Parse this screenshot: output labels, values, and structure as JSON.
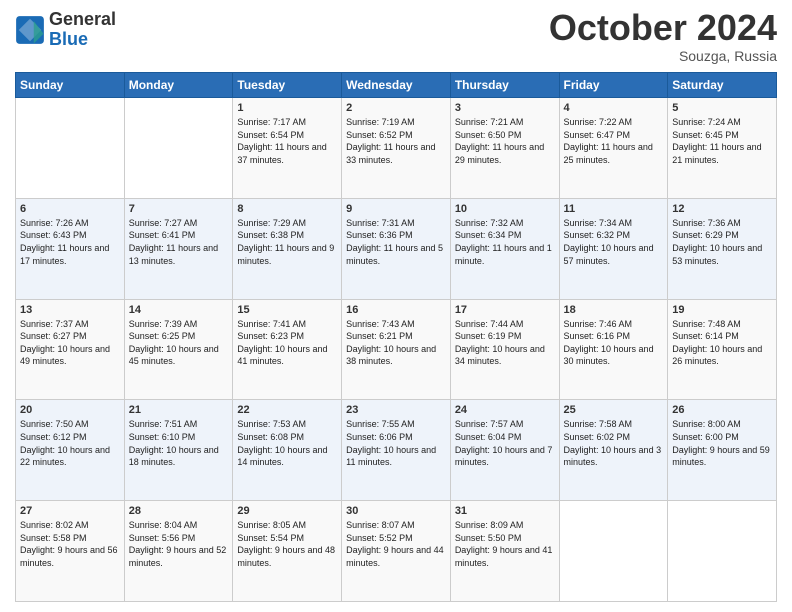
{
  "header": {
    "logo_text_general": "General",
    "logo_text_blue": "Blue",
    "month": "October 2024",
    "location": "Souzga, Russia"
  },
  "weekdays": [
    "Sunday",
    "Monday",
    "Tuesday",
    "Wednesday",
    "Thursday",
    "Friday",
    "Saturday"
  ],
  "weeks": [
    [
      {
        "day": "",
        "content": ""
      },
      {
        "day": "",
        "content": ""
      },
      {
        "day": "1",
        "content": "Sunrise: 7:17 AM\nSunset: 6:54 PM\nDaylight: 11 hours and 37 minutes."
      },
      {
        "day": "2",
        "content": "Sunrise: 7:19 AM\nSunset: 6:52 PM\nDaylight: 11 hours and 33 minutes."
      },
      {
        "day": "3",
        "content": "Sunrise: 7:21 AM\nSunset: 6:50 PM\nDaylight: 11 hours and 29 minutes."
      },
      {
        "day": "4",
        "content": "Sunrise: 7:22 AM\nSunset: 6:47 PM\nDaylight: 11 hours and 25 minutes."
      },
      {
        "day": "5",
        "content": "Sunrise: 7:24 AM\nSunset: 6:45 PM\nDaylight: 11 hours and 21 minutes."
      }
    ],
    [
      {
        "day": "6",
        "content": "Sunrise: 7:26 AM\nSunset: 6:43 PM\nDaylight: 11 hours and 17 minutes."
      },
      {
        "day": "7",
        "content": "Sunrise: 7:27 AM\nSunset: 6:41 PM\nDaylight: 11 hours and 13 minutes."
      },
      {
        "day": "8",
        "content": "Sunrise: 7:29 AM\nSunset: 6:38 PM\nDaylight: 11 hours and 9 minutes."
      },
      {
        "day": "9",
        "content": "Sunrise: 7:31 AM\nSunset: 6:36 PM\nDaylight: 11 hours and 5 minutes."
      },
      {
        "day": "10",
        "content": "Sunrise: 7:32 AM\nSunset: 6:34 PM\nDaylight: 11 hours and 1 minute."
      },
      {
        "day": "11",
        "content": "Sunrise: 7:34 AM\nSunset: 6:32 PM\nDaylight: 10 hours and 57 minutes."
      },
      {
        "day": "12",
        "content": "Sunrise: 7:36 AM\nSunset: 6:29 PM\nDaylight: 10 hours and 53 minutes."
      }
    ],
    [
      {
        "day": "13",
        "content": "Sunrise: 7:37 AM\nSunset: 6:27 PM\nDaylight: 10 hours and 49 minutes."
      },
      {
        "day": "14",
        "content": "Sunrise: 7:39 AM\nSunset: 6:25 PM\nDaylight: 10 hours and 45 minutes."
      },
      {
        "day": "15",
        "content": "Sunrise: 7:41 AM\nSunset: 6:23 PM\nDaylight: 10 hours and 41 minutes."
      },
      {
        "day": "16",
        "content": "Sunrise: 7:43 AM\nSunset: 6:21 PM\nDaylight: 10 hours and 38 minutes."
      },
      {
        "day": "17",
        "content": "Sunrise: 7:44 AM\nSunset: 6:19 PM\nDaylight: 10 hours and 34 minutes."
      },
      {
        "day": "18",
        "content": "Sunrise: 7:46 AM\nSunset: 6:16 PM\nDaylight: 10 hours and 30 minutes."
      },
      {
        "day": "19",
        "content": "Sunrise: 7:48 AM\nSunset: 6:14 PM\nDaylight: 10 hours and 26 minutes."
      }
    ],
    [
      {
        "day": "20",
        "content": "Sunrise: 7:50 AM\nSunset: 6:12 PM\nDaylight: 10 hours and 22 minutes."
      },
      {
        "day": "21",
        "content": "Sunrise: 7:51 AM\nSunset: 6:10 PM\nDaylight: 10 hours and 18 minutes."
      },
      {
        "day": "22",
        "content": "Sunrise: 7:53 AM\nSunset: 6:08 PM\nDaylight: 10 hours and 14 minutes."
      },
      {
        "day": "23",
        "content": "Sunrise: 7:55 AM\nSunset: 6:06 PM\nDaylight: 10 hours and 11 minutes."
      },
      {
        "day": "24",
        "content": "Sunrise: 7:57 AM\nSunset: 6:04 PM\nDaylight: 10 hours and 7 minutes."
      },
      {
        "day": "25",
        "content": "Sunrise: 7:58 AM\nSunset: 6:02 PM\nDaylight: 10 hours and 3 minutes."
      },
      {
        "day": "26",
        "content": "Sunrise: 8:00 AM\nSunset: 6:00 PM\nDaylight: 9 hours and 59 minutes."
      }
    ],
    [
      {
        "day": "27",
        "content": "Sunrise: 8:02 AM\nSunset: 5:58 PM\nDaylight: 9 hours and 56 minutes."
      },
      {
        "day": "28",
        "content": "Sunrise: 8:04 AM\nSunset: 5:56 PM\nDaylight: 9 hours and 52 minutes."
      },
      {
        "day": "29",
        "content": "Sunrise: 8:05 AM\nSunset: 5:54 PM\nDaylight: 9 hours and 48 minutes."
      },
      {
        "day": "30",
        "content": "Sunrise: 8:07 AM\nSunset: 5:52 PM\nDaylight: 9 hours and 44 minutes."
      },
      {
        "day": "31",
        "content": "Sunrise: 8:09 AM\nSunset: 5:50 PM\nDaylight: 9 hours and 41 minutes."
      },
      {
        "day": "",
        "content": ""
      },
      {
        "day": "",
        "content": ""
      }
    ]
  ]
}
